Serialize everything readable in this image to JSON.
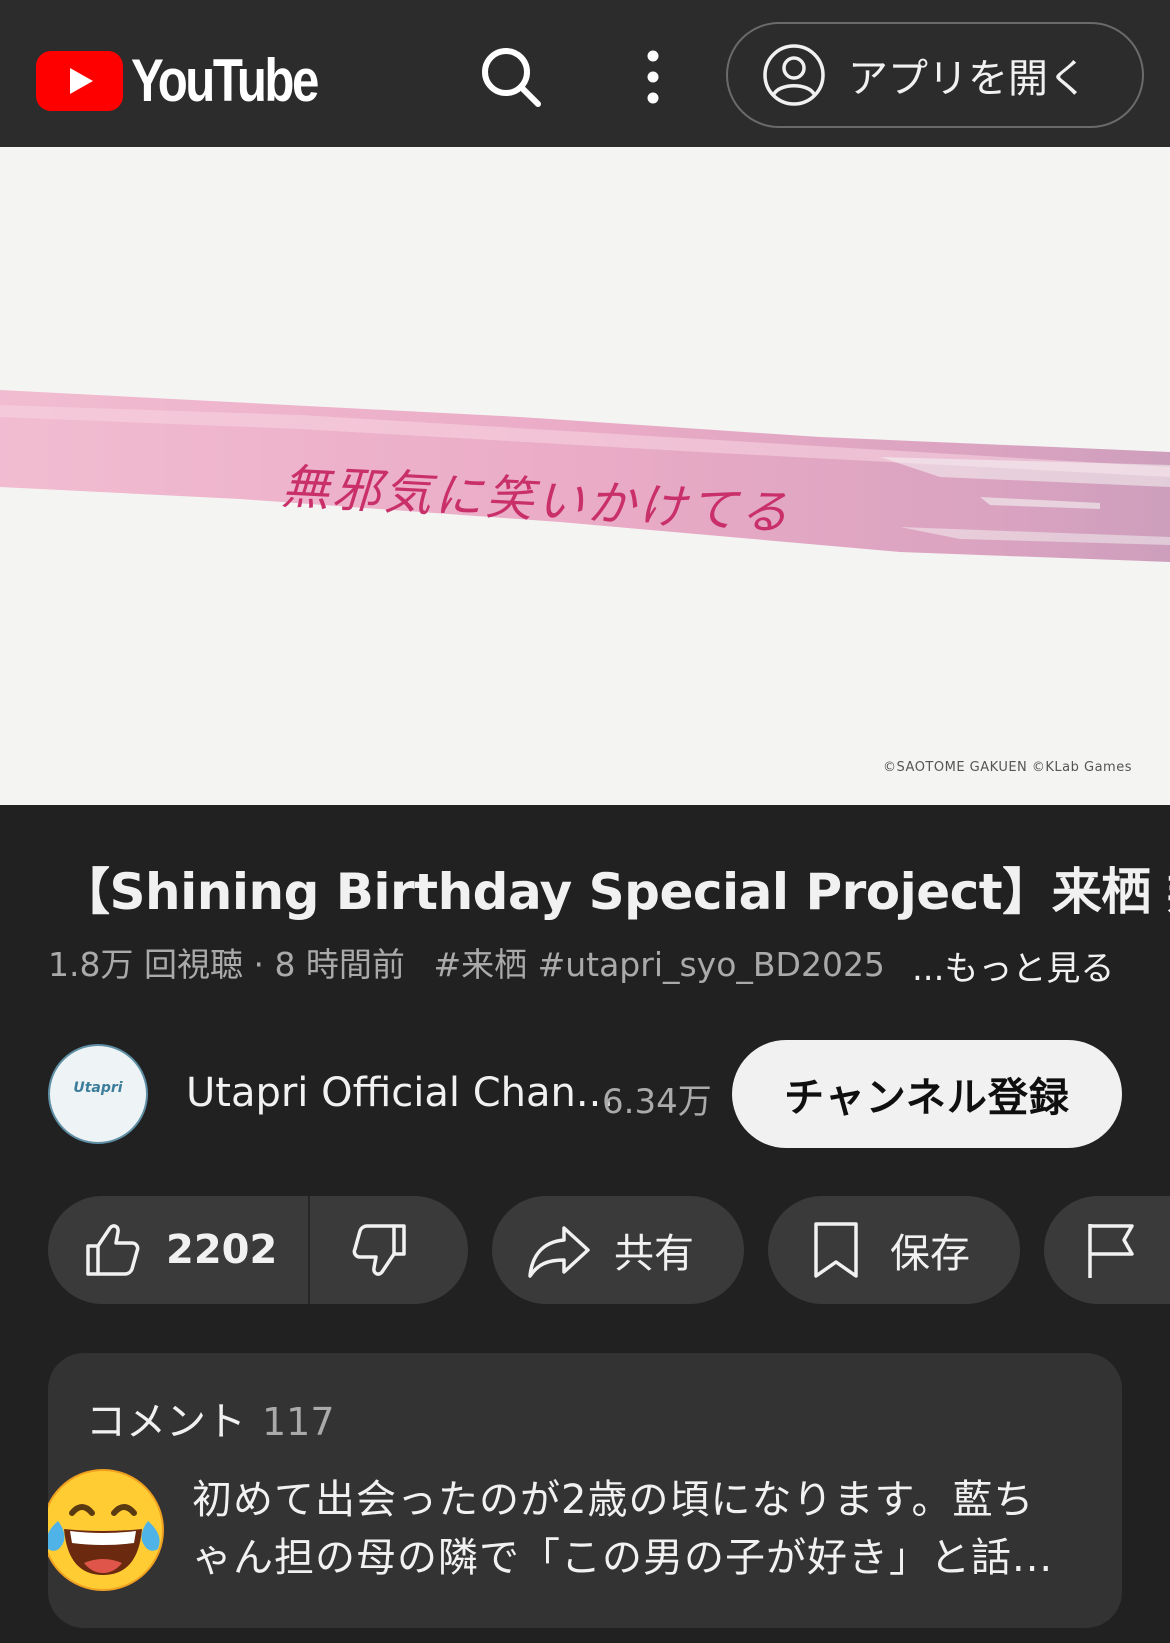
{
  "header": {
    "logo_text": "YouTube",
    "open_app_label": "アプリを開く",
    "icons": [
      "youtube-logo-icon",
      "search-icon",
      "more-vert-icon",
      "account-circle-icon"
    ]
  },
  "video": {
    "caption": "無邪気に笑いかけてる",
    "copyright": "©SAOTOME GAKUEN ©KLab Games"
  },
  "info": {
    "title": "【Shining Birthday Special Project】来栖 翔",
    "views_time": "1.8万 回視聴 · 8 時間前",
    "tags": "#来栖 #utapri_syo_BD2025",
    "more_label": "...もっと見る"
  },
  "channel": {
    "avatar_text": "Utapri",
    "name": "Utapri Official Chan...",
    "subscribers": "6.34万",
    "subscribe_label": "チャンネル登録"
  },
  "actions": {
    "like_count": "2202",
    "share_label": "共有",
    "save_label": "保存",
    "icons": [
      "thumb-up-icon",
      "thumb-down-icon",
      "share-icon",
      "bookmark-icon",
      "flag-icon"
    ]
  },
  "comments": {
    "label": "コメント",
    "count": "117",
    "line1": "初めて出会ったのが2歳の頃になります。藍ち",
    "line2": "ゃん担の母の隣で「この男の子が好き」と話...",
    "emoji": "😂"
  },
  "colors": {
    "background": "#212121",
    "header": "#2c2c2c",
    "youtube_red": "#ff0000",
    "pill": "#3a3a3a",
    "brush": "#e8a5c2"
  }
}
